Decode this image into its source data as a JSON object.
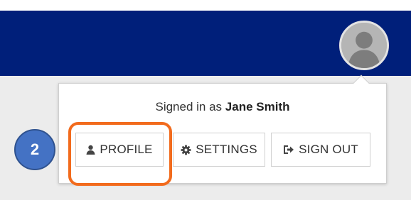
{
  "header": {
    "avatar_icon": "user-avatar-icon",
    "background_color": "#001f7a"
  },
  "menu": {
    "signed_in_prefix": "Signed in as",
    "user_name": "Jane Smith",
    "buttons": [
      {
        "label": "PROFILE",
        "icon": "user-icon"
      },
      {
        "label": "SETTINGS",
        "icon": "gear-icon"
      },
      {
        "label": "SIGN OUT",
        "icon": "sign-out-icon"
      }
    ]
  },
  "annotation": {
    "step_number": "2",
    "highlight_color": "#f26b1d",
    "badge_color": "#4472c4"
  }
}
